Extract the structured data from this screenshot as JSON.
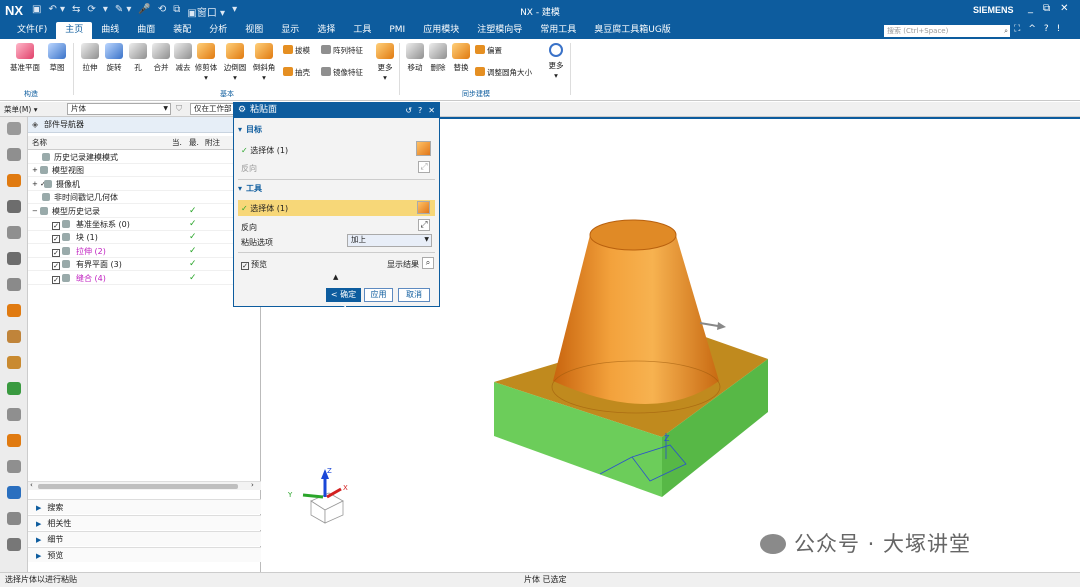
{
  "titlebar": {
    "logo": "NX",
    "quick_access": [
      "▣",
      "↶ ▾",
      "⇆",
      "⟳",
      "▾",
      "✎ ▾",
      "🎤",
      "⟲",
      "⧉",
      "▣窗口 ▾",
      "▾"
    ],
    "window_title": "NX - 建模",
    "brand": "SIEMENS",
    "window_controls": [
      "_",
      "⧉",
      "✕"
    ]
  },
  "menubar": {
    "tabs": [
      "文件(F)",
      "主页",
      "曲线",
      "曲面",
      "装配",
      "分析",
      "视图",
      "显示",
      "选择",
      "工具",
      "PMI",
      "应用模块",
      "注塑模向导",
      "常用工具",
      "臭豆腐工具箱UG版"
    ],
    "active_tab": "主页",
    "search_placeholder": "搜索 (Ctrl+Space)",
    "right_icons": [
      "⛶",
      "^",
      "?",
      "!"
    ]
  },
  "ribbon": {
    "construct": {
      "group_label": "构造",
      "buttons": [
        "基准平面",
        "草图"
      ]
    },
    "basic": {
      "group_label": "基本",
      "buttons": [
        "拉伸",
        "旋转",
        "孔",
        "合并",
        "减去",
        "修剪体",
        "边倒圆",
        "倒斜角"
      ],
      "small_buttons": [
        "拔模",
        "阵列特征",
        "抽壳",
        "镜像特征"
      ],
      "more": "更多"
    },
    "sync": {
      "group_label": "同步建模",
      "buttons": [
        "移动",
        "删除",
        "替换"
      ],
      "small_buttons": [
        "偏置",
        "调整圆角大小"
      ],
      "more": "更多"
    }
  },
  "selbar": {
    "menu": "菜单(M) ▾",
    "filter": "片体",
    "scope": "仅在工作部"
  },
  "navigator": {
    "title": "部件导航器",
    "columns": [
      "名称",
      "当.",
      "最.",
      "附注"
    ],
    "rows": [
      {
        "label": "历史记录建模模式",
        "indent": 1,
        "check": ""
      },
      {
        "label": "模型视图",
        "indent": 0,
        "check": "",
        "prefix": "+"
      },
      {
        "label": "摄像机",
        "indent": 0,
        "check": "",
        "prefix": "+ ✓"
      },
      {
        "label": "非时间戳记几何体",
        "indent": 1,
        "check": ""
      },
      {
        "label": "模型历史记录",
        "indent": 0,
        "check": "✓",
        "prefix": "−"
      },
      {
        "label": "基准坐标系 (0)",
        "indent": 2,
        "check": "✓"
      },
      {
        "label": "块 (1)",
        "indent": 2,
        "check": "✓"
      },
      {
        "label": "拉伸 (2)",
        "indent": 2,
        "check": "✓",
        "color": "#c020c0"
      },
      {
        "label": "有界平面 (3)",
        "indent": 2,
        "check": "✓"
      },
      {
        "label": "缝合 (4)",
        "indent": 2,
        "check": "✓",
        "color": "#c020c0"
      }
    ],
    "sections": [
      "搜索",
      "相关性",
      "细节",
      "预览"
    ]
  },
  "dialog": {
    "title": "粘贴面",
    "controls": [
      "↺",
      "?",
      "✕"
    ],
    "target_header": "目标",
    "target_select": "选择体 (1)",
    "target_reverse": "反向",
    "tool_header": "工具",
    "tool_select": "选择体 (1)",
    "tool_reverse": "反向",
    "paste_option_label": "粘贴选项",
    "paste_option_value": "加上",
    "preview_label": "预览",
    "show_result": "显示结果",
    "ok": "< 确定 >",
    "apply": "应用",
    "cancel": "取消"
  },
  "viewport": {
    "colors": {
      "cone": "#e8932f",
      "cone_shadow": "#c86a12",
      "box_top": "#c08a1e",
      "box_front": "#6ccd5a",
      "box_side": "#57b846"
    }
  },
  "status": {
    "left": "选择片体以进行粘贴",
    "center": "片体 已选定"
  },
  "watermark": "公众号 · 大塚讲堂"
}
